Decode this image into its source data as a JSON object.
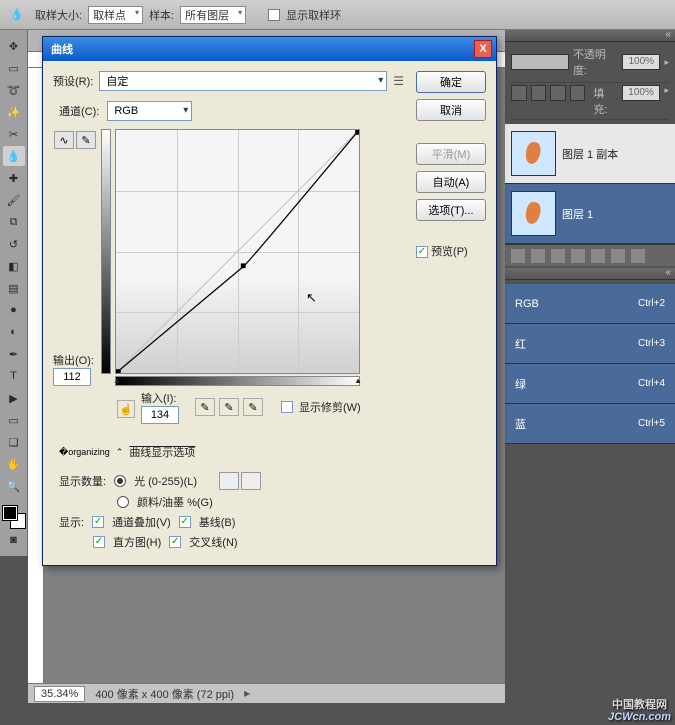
{
  "options": {
    "sample_size_label": "取样大小:",
    "sample_size_value": "取样点",
    "sample_label": "样本:",
    "sample_value": "所有图层",
    "show_ring_label": "显示取样环"
  },
  "dialog": {
    "title": "曲线",
    "preset_label": "预设(R):",
    "preset_value": "自定",
    "channel_label": "通道(C):",
    "channel_value": "RGB",
    "output_label": "输出(O):",
    "output_value": "112",
    "input_label": "输入(I):",
    "input_value": "134",
    "show_clip_label": "显示修剪(W)",
    "disclosure_label": "曲线显示选项",
    "display_qty_label": "显示数量:",
    "light_label": "光 (0-255)(L)",
    "ink_label": "颜料/油墨 %(G)",
    "show_label": "显示:",
    "channel_overlay_label": "通道叠加(V)",
    "baseline_label": "基线(B)",
    "histogram_label": "直方图(H)",
    "intersection_label": "交叉线(N)",
    "ok": "确定",
    "cancel": "取消",
    "smooth": "平滑(M)",
    "auto": "自动(A)",
    "options_btn": "选项(T)...",
    "preview_label": "预览(P)"
  },
  "chart_data": {
    "type": "line",
    "title": "曲线",
    "xlabel": "输入",
    "ylabel": "输出",
    "xlim": [
      0,
      255
    ],
    "ylim": [
      0,
      255
    ],
    "series": [
      {
        "name": "RGB",
        "points": [
          [
            0,
            0
          ],
          [
            134,
            112
          ],
          [
            255,
            255
          ]
        ]
      }
    ],
    "baseline": [
      [
        0,
        0
      ],
      [
        255,
        255
      ]
    ],
    "grid": true
  },
  "layers_panel": {
    "opacity_label": "不透明度:",
    "opacity_value": "100%",
    "fill_label": "填充:",
    "fill_value": "100%",
    "items": [
      {
        "name": "图层 1 副本"
      },
      {
        "name": "图层 1"
      }
    ]
  },
  "channels_panel": {
    "items": [
      {
        "name": "RGB",
        "shortcut": "Ctrl+2"
      },
      {
        "name": "红",
        "shortcut": "Ctrl+3"
      },
      {
        "name": "绿",
        "shortcut": "Ctrl+4"
      },
      {
        "name": "蓝",
        "shortcut": "Ctrl+5"
      }
    ]
  },
  "status": {
    "zoom": "35.34%",
    "doc_info": "400 像素 x 400 像素 (72 ppi)"
  },
  "watermark": {
    "cn": "中国教程网",
    "url": "JCWcn.com"
  }
}
